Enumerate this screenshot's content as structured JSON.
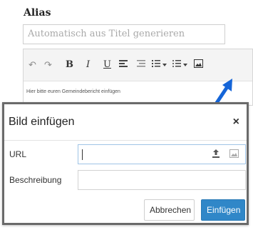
{
  "form": {
    "alias_label": "Alias",
    "alias_placeholder": "Automatisch aus Titel generieren"
  },
  "editor": {
    "placeholder": "Hier bitte euren Gemeindebericht einfügen",
    "toolbar_icons": [
      "undo-icon",
      "redo-icon",
      "bold-icon",
      "italic-icon",
      "underline-icon",
      "align-left-icon",
      "align-center-icon",
      "ordered-list-icon",
      "unordered-list-icon",
      "image-icon"
    ],
    "bold": "B",
    "italic": "I",
    "underline": "U"
  },
  "dialog": {
    "title": "Bild einfügen",
    "close": "×",
    "url_label": "URL",
    "url_value": "",
    "description_label": "Beschreibung",
    "description_value": "",
    "cancel_label": "Abbrechen",
    "insert_label": "Einfügen"
  },
  "colors": {
    "accent": "#3087c8",
    "arrow": "#1565d8"
  }
}
